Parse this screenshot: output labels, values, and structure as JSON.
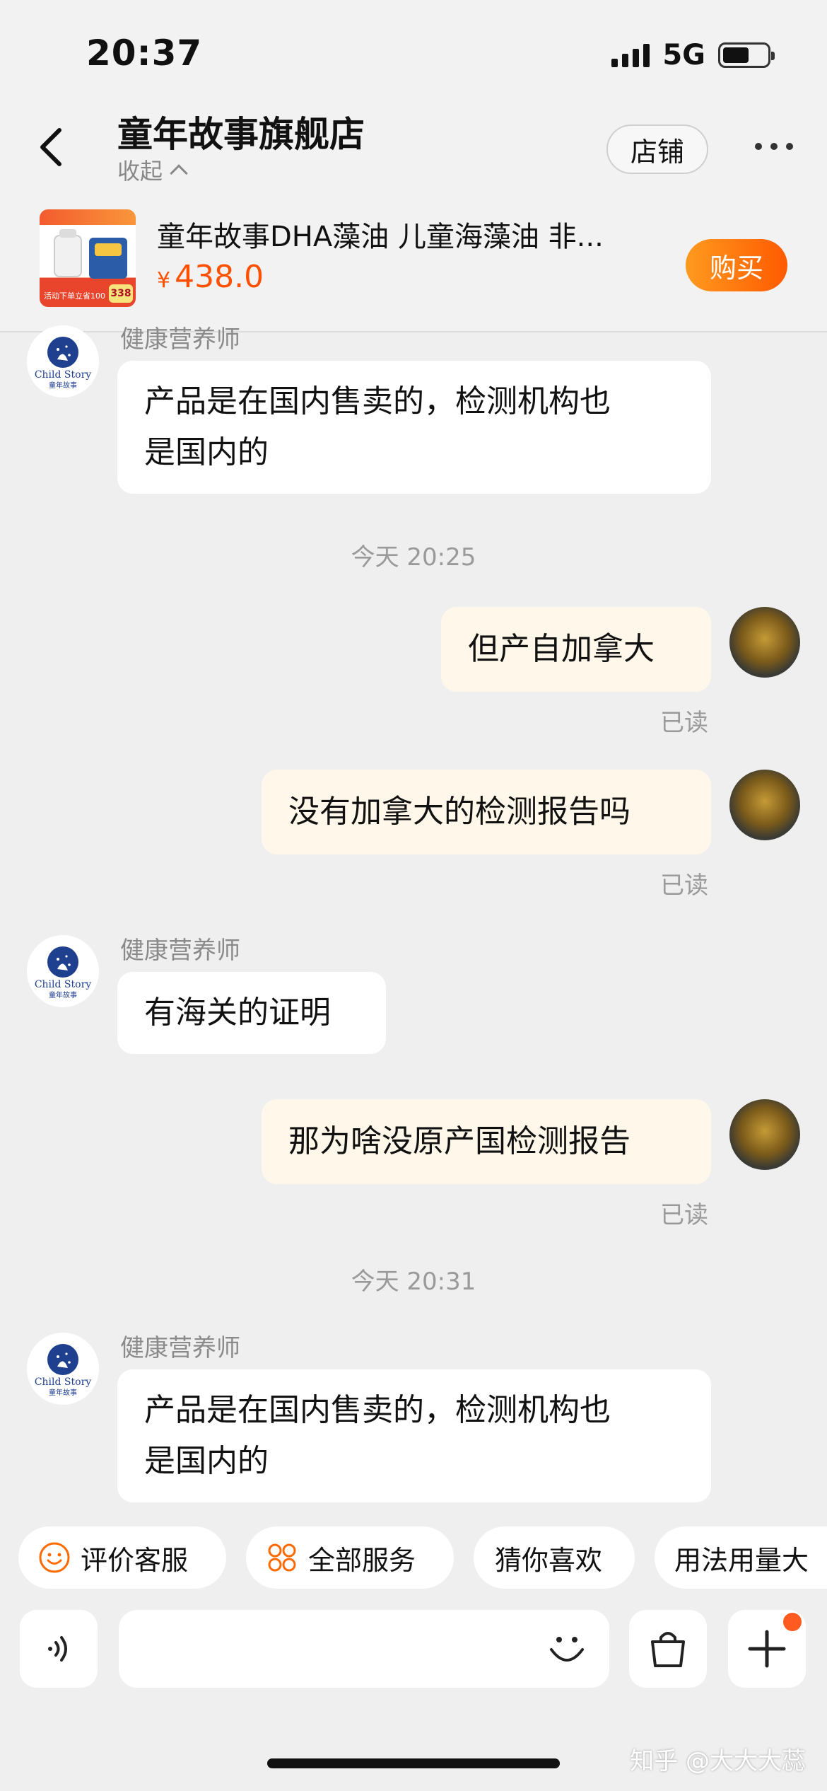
{
  "status_bar": {
    "time": "20:37",
    "network": "5G"
  },
  "header": {
    "title": "童年故事旗舰店",
    "collapse_label": "收起",
    "shop_button": "店铺"
  },
  "product": {
    "name": "童年故事DHA藻油 儿童海藻油 非...",
    "currency": "¥",
    "price": "438.0",
    "buy_button": "购买",
    "image_text": "活动下单立省100",
    "image_badge": "338"
  },
  "store_avatar_text": {
    "en": "Child Story",
    "cn": "童年故事"
  },
  "messages": [
    {
      "type": "in",
      "sender": "健康营养师",
      "lines": [
        "产品是在国内售卖的，检测机构也",
        "是国内的"
      ]
    },
    {
      "type": "time",
      "text": "今天 20:25"
    },
    {
      "type": "out",
      "text": "但产自加拿大",
      "read": "已读"
    },
    {
      "type": "out",
      "text": "没有加拿大的检测报告吗",
      "read": "已读"
    },
    {
      "type": "in",
      "sender": "健康营养师",
      "lines": [
        "有海关的证明"
      ]
    },
    {
      "type": "out",
      "text": "那为啥没原产国检测报告",
      "read": "已读"
    },
    {
      "type": "time",
      "text": "今天 20:31"
    },
    {
      "type": "in",
      "sender": "健康营养师",
      "lines": [
        "产品是在国内售卖的，检测机构也",
        "是国内的"
      ]
    }
  ],
  "quick_actions": [
    {
      "label": "评价客服",
      "icon": "smiley-icon"
    },
    {
      "label": "全部服务",
      "icon": "grid-icon"
    },
    {
      "label": "猜你喜欢",
      "icon": ""
    },
    {
      "label": "用法用量大",
      "icon": ""
    }
  ],
  "watermark": "知乎 @大大大蕊",
  "colors": {
    "accent": "#ff5000",
    "bubble_out": "#fff8ea",
    "bubble_in": "#ffffff"
  }
}
